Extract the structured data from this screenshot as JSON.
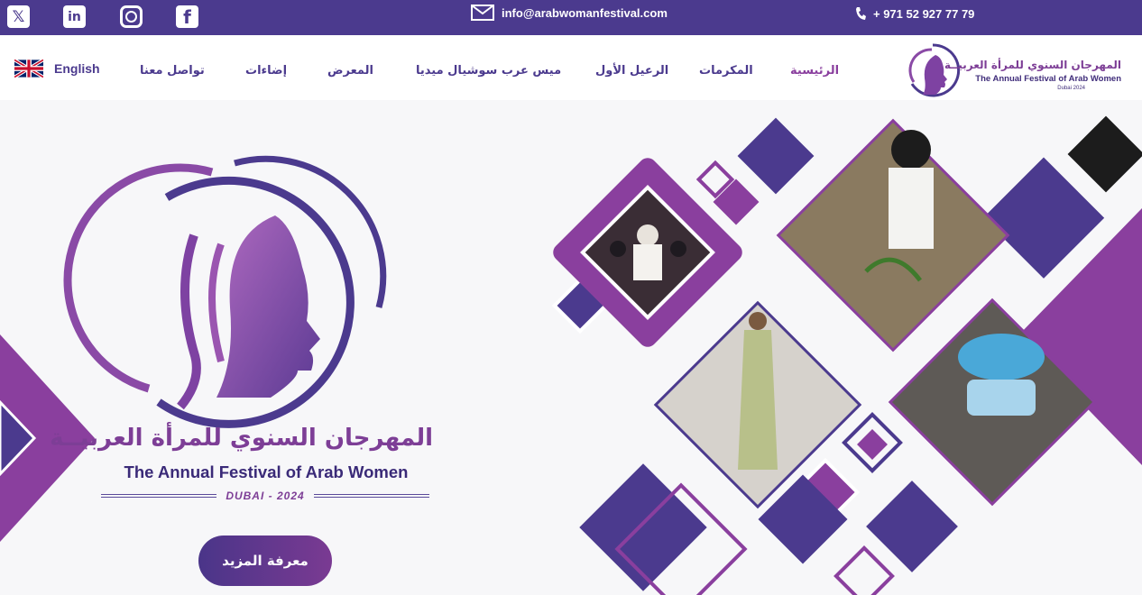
{
  "topbar": {
    "social": [
      {
        "name": "x-icon",
        "glyph": "𝕏"
      },
      {
        "name": "linkedin-icon",
        "glyph": "in"
      },
      {
        "name": "instagram-icon",
        "glyph": ""
      },
      {
        "name": "facebook-icon",
        "glyph": "f"
      }
    ],
    "email": "info@arabwomanfestival.com",
    "phone": "+ 971 52 927 77 79"
  },
  "navbar": {
    "language": "English",
    "items": [
      {
        "label": "الرئيسية",
        "active": true
      },
      {
        "label": "المكرمات",
        "active": false
      },
      {
        "label": "الرعيل الأول",
        "active": false
      },
      {
        "label": "ميس عرب سوشيال ميديا",
        "active": false
      },
      {
        "label": "المعرض",
        "active": false
      },
      {
        "label": "إضاءات",
        "active": false
      },
      {
        "label": "تواصل معنا",
        "active": false
      }
    ],
    "brand": {
      "title_ar": "المهرجان السنوي للمرأة العربيــة",
      "title_en": "The Annual Festival of Arab Women",
      "location": "Dubai 2024"
    }
  },
  "hero": {
    "title_ar": "المهرجان السنوي للمرأة العربيــة",
    "title_en": "The Annual Festival of Arab Women",
    "subtitle": "DUBAI - 2024",
    "cta_label": "معرفة المزيد"
  },
  "colors": {
    "primary": "#4b3a8e",
    "accent": "#7d3e96",
    "dark": "#1c1c1c"
  }
}
